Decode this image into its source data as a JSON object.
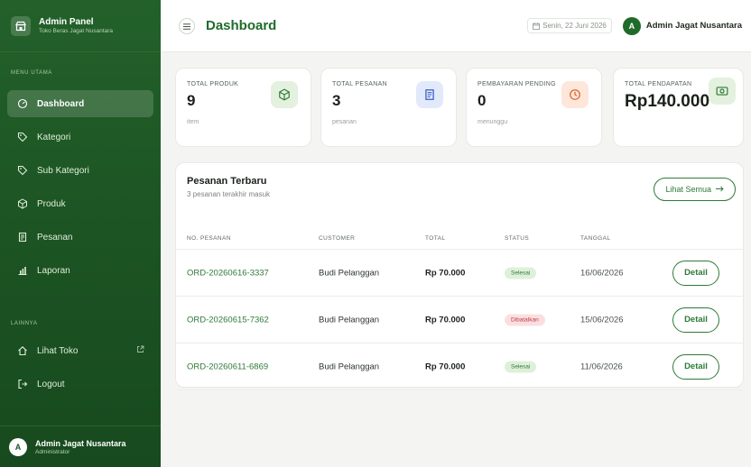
{
  "brand": {
    "title": "Admin Panel",
    "subtitle": "Toko Beras Jagat Nusantara",
    "icon": "store-icon"
  },
  "sidebar": {
    "section_main": "MENU UTAMA",
    "items": [
      {
        "label": "Dashboard",
        "icon": "gauge-icon",
        "active": true
      },
      {
        "label": "Kategori",
        "icon": "tag-icon"
      },
      {
        "label": "Sub Kategori",
        "icon": "tag-icon"
      },
      {
        "label": "Produk",
        "icon": "box-icon"
      },
      {
        "label": "Pesanan",
        "icon": "receipt-icon"
      },
      {
        "label": "Laporan",
        "icon": "bar-chart-icon"
      }
    ],
    "section_other": "LAINNYA",
    "other_items": [
      {
        "label": "Lihat Toko",
        "icon": "home-icon"
      },
      {
        "label": "Logout",
        "icon": "logout-icon"
      }
    ],
    "user": {
      "initial": "A",
      "name": "Admin Jagat Nusantara",
      "role": "Administrator"
    }
  },
  "header": {
    "title": "Dashboard",
    "date": "Senin, 22 Juni 2026",
    "user_initial": "A",
    "user_name": "Admin Jagat Nusantara"
  },
  "stats": [
    {
      "label": "TOTAL PRODUK",
      "value": "9",
      "sub": "item",
      "icon": "box-icon",
      "color": "#2f7a37",
      "bg": "#e3f1de"
    },
    {
      "label": "TOTAL PESANAN",
      "value": "3",
      "sub": "pesanan",
      "icon": "receipt-icon",
      "color": "#3a62c9",
      "bg": "#e2e9fb"
    },
    {
      "label": "PEMBAYARAN PENDING",
      "value": "0",
      "sub": "menunggu",
      "icon": "clock-icon",
      "color": "#e0692e",
      "bg": "#fde6da"
    },
    {
      "label": "TOTAL PENDAPATAN",
      "value": "Rp140.000",
      "sub": "",
      "icon": "money-icon",
      "color": "#2f7a37",
      "bg": "#e3f1de"
    }
  ],
  "orders": {
    "title": "Pesanan Terbaru",
    "subtitle": "3 pesanan terakhir masuk",
    "see_all": "Lihat Semua",
    "columns": [
      "NO. PESANAN",
      "CUSTOMER",
      "TOTAL",
      "STATUS",
      "TANGGAL"
    ],
    "rows": [
      {
        "no": "ORD-20260616-3337",
        "customer": "Budi Pelanggan",
        "total": "Rp 70.000",
        "status": "Selesai",
        "status_type": "done",
        "date": "16/06/2026",
        "action": "Detail"
      },
      {
        "no": "ORD-20260615-7362",
        "customer": "Budi Pelanggan",
        "total": "Rp 70.000",
        "status": "Dibatalkan",
        "status_type": "cancel",
        "date": "15/06/2026",
        "action": "Detail"
      },
      {
        "no": "ORD-20260611-6869",
        "customer": "Budi Pelanggan",
        "total": "Rp 70.000",
        "status": "Selesai",
        "status_type": "done",
        "date": "11/06/2026",
        "action": "Detail"
      }
    ]
  },
  "colors": {
    "primary": "#1f6b2a",
    "accent": "#2f7a37",
    "danger": "#c0393f"
  }
}
